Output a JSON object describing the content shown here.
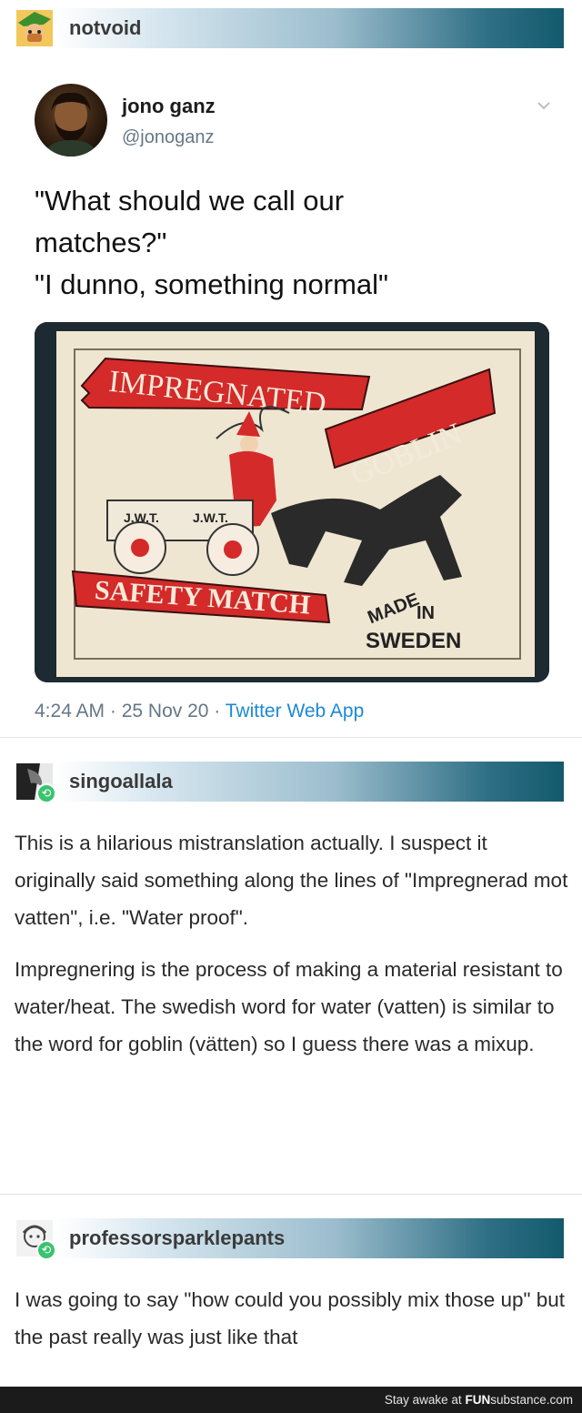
{
  "post": {
    "username": "notvoid",
    "avatar_icon": "green-hat-character-avatar"
  },
  "tweet": {
    "name": "jono ganz",
    "handle": "@jonoganz",
    "chevron_icon": "chevron-down-icon",
    "text_lines": [
      "\"What should we call our",
      "matches?\"",
      "\"I dunno, something normal\""
    ],
    "image": {
      "top_banner": "IMPREGNATED",
      "right_banner": "GOBLIN",
      "cart_labels": [
        "J.W.T.",
        "J.W.T."
      ],
      "bottom_banner": "SAFETY MATCH",
      "made": "MADE",
      "in": "IN",
      "country": "SWEDEN"
    },
    "time": "4:24 AM",
    "sep1": " · ",
    "date": "25 Nov 20",
    "sep2": " · ",
    "app": "Twitter Web App"
  },
  "reblog1": {
    "username": "singoallala",
    "badge_icon": "reblog-icon",
    "paragraphs": [
      "This is a hilarious mistranslation actually. I suspect it originally said something along the lines of \"Impregnerad mot vatten\", i.e. \"Water proof\".",
      "Impregnering is the process of making a material resistant to water/heat. The swedish word for water (vatten) is similar to the word for goblin (vätten) so I guess there was a mixup."
    ]
  },
  "reblog2": {
    "username": "professorsparklepants",
    "badge_icon": "reblog-icon",
    "paragraphs": [
      "I was going to say \"how could you possibly mix those up\" but the past really was just like that"
    ]
  },
  "footer": {
    "prefix": "Stay awake at ",
    "brand_bold": "FUN",
    "brand_rest": "substance.com"
  },
  "colors": {
    "header_gradient_end": "#135a6d",
    "reblog_green": "#3ac36e",
    "twitter_blue": "#1b8ad6",
    "banner_red": "#d42a2a"
  }
}
